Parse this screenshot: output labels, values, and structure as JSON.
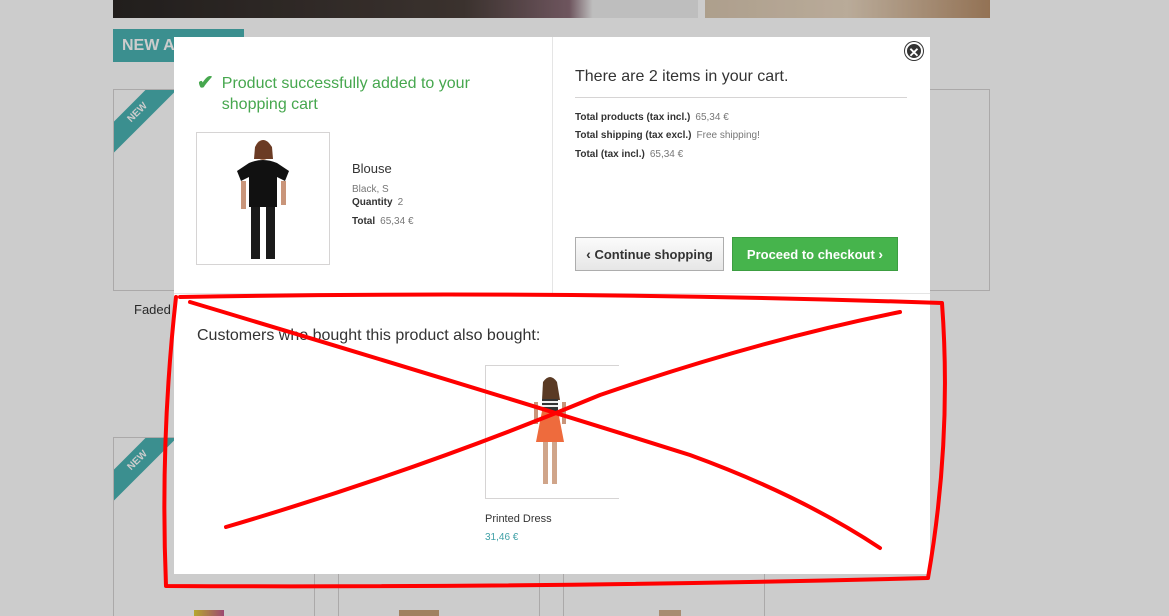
{
  "background": {
    "section_tab": "NEW A",
    "ribbon_label": "NEW",
    "product_name": "Faded"
  },
  "modal": {
    "close_icon": "close-icon",
    "success_icon": "check-icon",
    "success_message": "Product successfully added to your shopping cart",
    "product": {
      "name": "Blouse",
      "attributes": "Black, S",
      "quantity_label": "Quantity",
      "quantity_value": "2",
      "total_label": "Total",
      "total_value": "65,34 €"
    },
    "cart": {
      "heading": "There are 2 items in your cart.",
      "total_products_label": "Total products (tax incl.)",
      "total_products_value": "65,34 €",
      "total_shipping_label": "Total shipping (tax excl.)",
      "total_shipping_value": "Free shipping!",
      "total_label": "Total (tax incl.)",
      "total_value": "65,34 €"
    },
    "buttons": {
      "continue_label": "Continue shopping",
      "checkout_label": "Proceed to checkout"
    },
    "also_bought": {
      "heading": "Customers who bought this product also bought:",
      "items": [
        {
          "name": "Printed Dress",
          "price": "31,46 €"
        }
      ]
    }
  },
  "colors": {
    "success_green": "#46a74e",
    "checkout_green": "#46b44c",
    "teal_accent": "#4ab3b3",
    "annotation_red": "#ff0000"
  }
}
